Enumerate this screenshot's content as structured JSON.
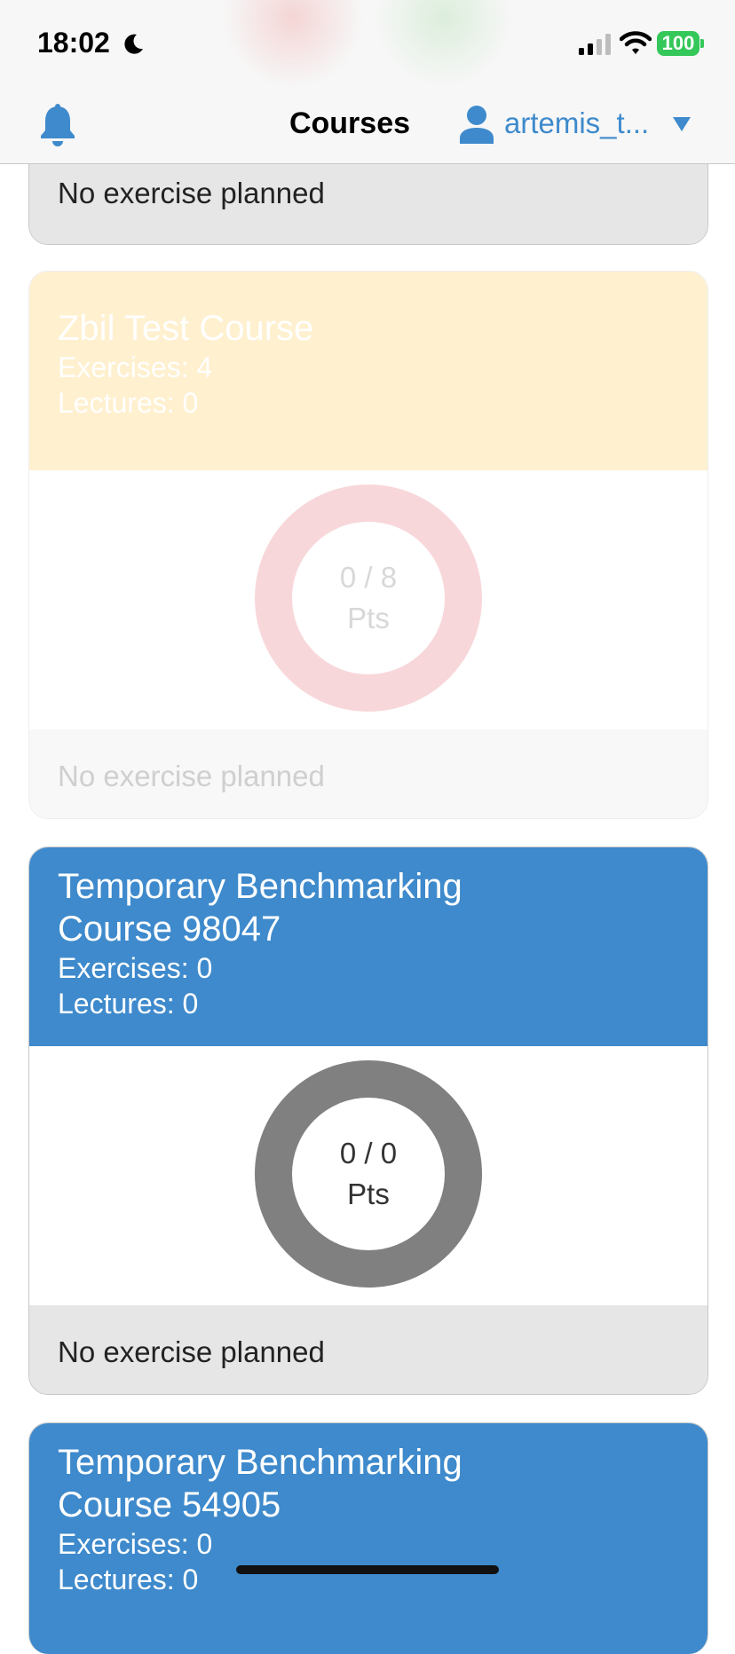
{
  "status_bar": {
    "time": "18:02",
    "battery": "100",
    "battery_color": "#34c759"
  },
  "nav": {
    "title": "Courses",
    "username": "artemis_t...",
    "accent_color": "#3e8acc",
    "icons": [
      "bell-icon",
      "user-icon",
      "caret-down-icon"
    ]
  },
  "courses": [
    {
      "footer": "No exercise planned"
    },
    {
      "title": "Zbil Test Course",
      "exercises": "Exercises: 4",
      "lectures": "Lectures: 0",
      "points": "0 / 8",
      "points_unit": "Pts",
      "footer": "No exercise planned",
      "ring_color": "#f8d7da",
      "header_color": "#fff0cf",
      "faded": true
    },
    {
      "title": "Temporary Benchmarking Course 98047",
      "exercises": "Exercises: 0",
      "lectures": "Lectures: 0",
      "points": "0 / 0",
      "points_unit": "Pts",
      "footer": "No exercise planned",
      "ring_color": "#808080",
      "header_color": "#3e8acc"
    },
    {
      "title": "Temporary Benchmarking Course 54905",
      "exercises": "Exercises: 0",
      "lectures": "Lectures: 0",
      "header_color": "#3e8acc"
    }
  ]
}
